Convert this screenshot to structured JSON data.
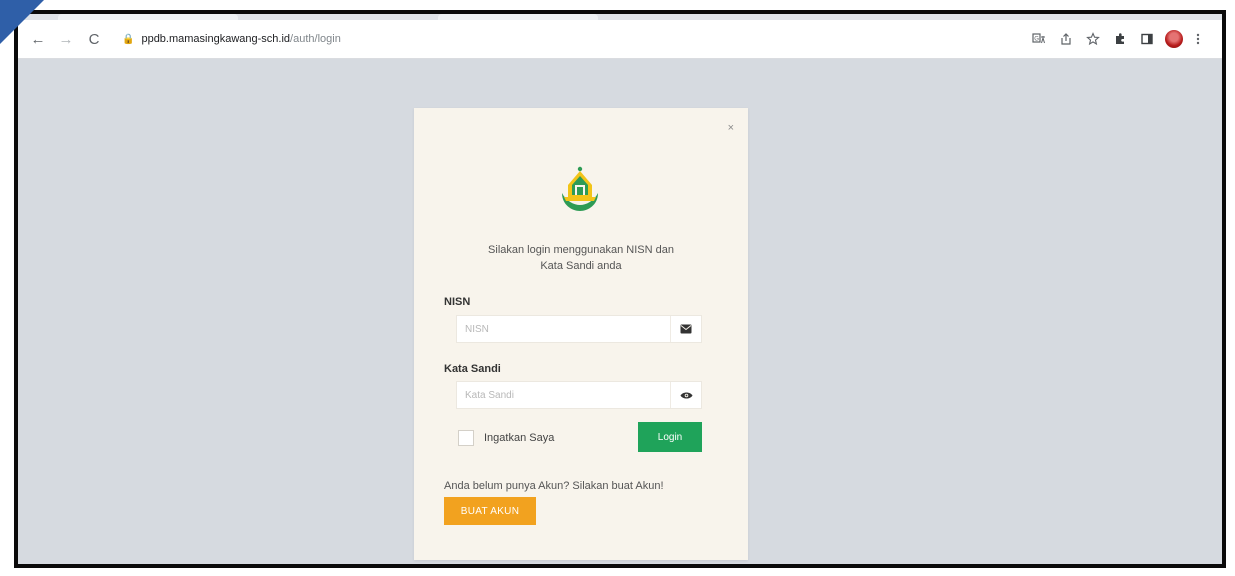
{
  "browser": {
    "url_host": "ppdb.mamasingkawang-sch.id",
    "url_path": "/auth/login",
    "nav": {
      "back": "←",
      "forward": "→",
      "reload": "C"
    },
    "icons": [
      "translate-icon",
      "share-icon",
      "star-icon",
      "extensions-icon",
      "side-panel-icon",
      "profile-avatar",
      "menu-icon"
    ]
  },
  "modal": {
    "close": "×",
    "intro_line1": "Silakan login menggunakan NISN dan",
    "intro_line2": "Kata Sandi anda",
    "nisn_label": "NISN",
    "nisn_placeholder": "NISN",
    "password_label": "Kata Sandi",
    "password_placeholder": "Kata Sandi",
    "remember_label": "Ingatkan Saya",
    "login_button": "Login",
    "register_text": "Anda belum punya Akun? Silakan buat Akun!",
    "register_button": "BUAT AKUN"
  },
  "colors": {
    "login_green": "#1fa35a",
    "register_orange": "#f2a21f",
    "modal_bg": "#f8f4ec",
    "page_bg": "#d6dae0"
  }
}
